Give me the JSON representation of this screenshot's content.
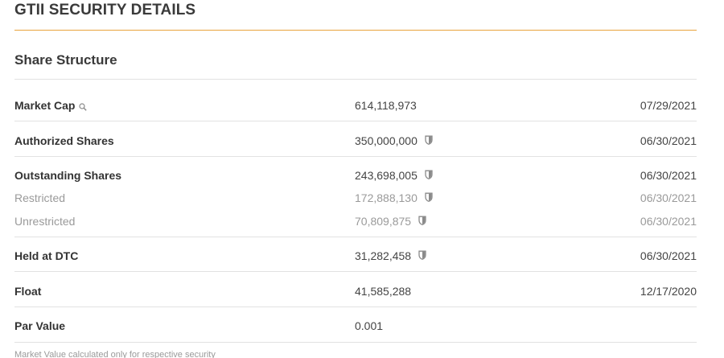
{
  "header": {
    "title": "GTII SECURITY DETAILS"
  },
  "share_structure": {
    "title": "Share Structure",
    "rows": [
      {
        "label": "Market Cap",
        "value": "614,118,973",
        "date": "07/29/2021",
        "icon": "magnify-icon"
      },
      {
        "label": "Authorized Shares",
        "value": "350,000,000",
        "date": "06/30/2021",
        "icon": "shield-icon"
      },
      {
        "label": "Outstanding Shares",
        "value": "243,698,005",
        "date": "06/30/2021",
        "icon": "shield-icon"
      },
      {
        "label": "Restricted",
        "value": "172,888,130",
        "date": "06/30/2021",
        "icon": "shield-icon"
      },
      {
        "label": "Unrestricted",
        "value": "70,809,875",
        "date": "06/30/2021",
        "icon": "shield-icon"
      },
      {
        "label": "Held at DTC",
        "value": "31,282,458",
        "date": "06/30/2021",
        "icon": "shield-icon"
      },
      {
        "label": "Float",
        "value": "41,585,288",
        "date": "12/17/2020"
      },
      {
        "label": "Par Value",
        "value": "0.001",
        "date": ""
      }
    ]
  },
  "footnote": "Market Value calculated only for respective security",
  "colors": {
    "accent_rule": "#e8a33d",
    "divider": "#e2e2e2",
    "muted_text": "#9a9a9a",
    "primary_text": "#333333"
  }
}
